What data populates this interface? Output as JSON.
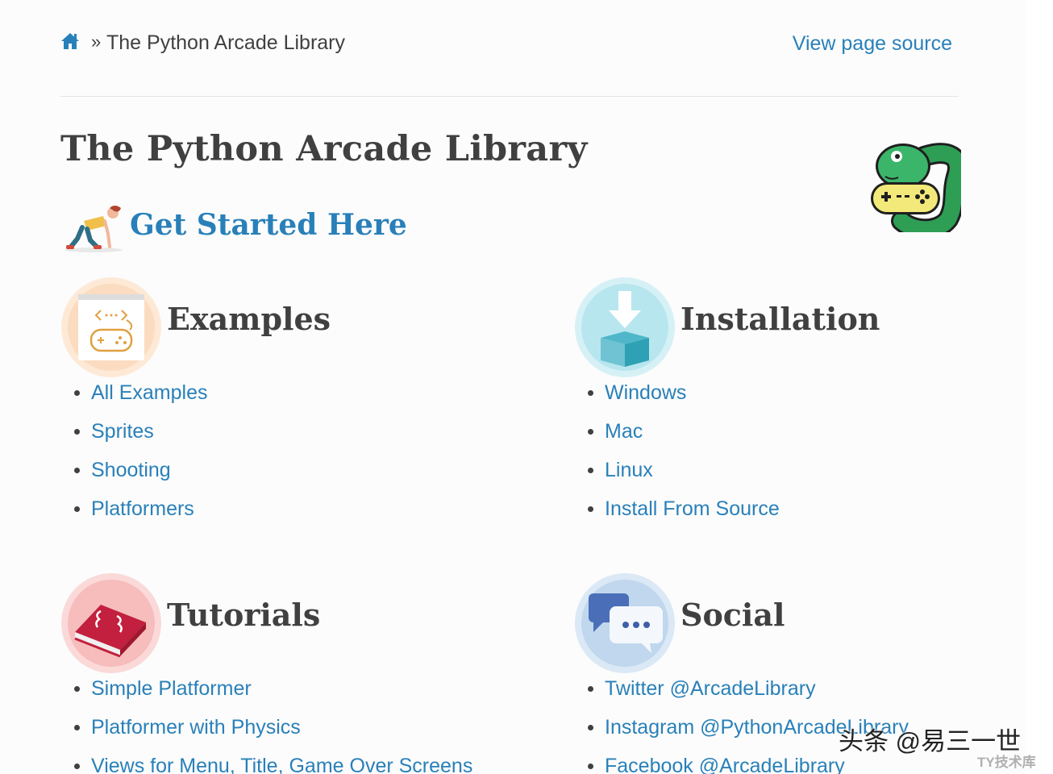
{
  "breadcrumbs": {
    "home_icon": "home-icon",
    "separator": "»",
    "current": "The Python Arcade Library",
    "view_source": "View page source"
  },
  "page": {
    "title": "The Python Arcade Library",
    "get_started": "Get Started Here",
    "mascot_icon": "python-gamepad-mascot"
  },
  "sections": {
    "examples": {
      "heading": "Examples",
      "icon": "code-gamepad-icon",
      "links": [
        "All Examples",
        "Sprites",
        "Shooting",
        "Platformers"
      ]
    },
    "installation": {
      "heading": "Installation",
      "icon": "download-box-icon",
      "links": [
        "Windows",
        "Mac",
        "Linux",
        "Install From Source"
      ]
    },
    "tutorials": {
      "heading": "Tutorials",
      "icon": "code-book-icon",
      "links": [
        "Simple Platformer",
        "Platformer with Physics",
        "Views for Menu, Title, Game Over Screens"
      ]
    },
    "social": {
      "heading": "Social",
      "icon": "chat-bubbles-icon",
      "links": [
        "Twitter @ArcadeLibrary",
        "Instagram @PythonArcadeLibrary",
        "Facebook @ArcadeLibrary"
      ]
    }
  },
  "watermark": {
    "text": "头条 @易三一世",
    "sub": "TY技术库"
  },
  "colors": {
    "link": "#2980b9",
    "text": "#404040",
    "background": "#fcfcfc"
  }
}
